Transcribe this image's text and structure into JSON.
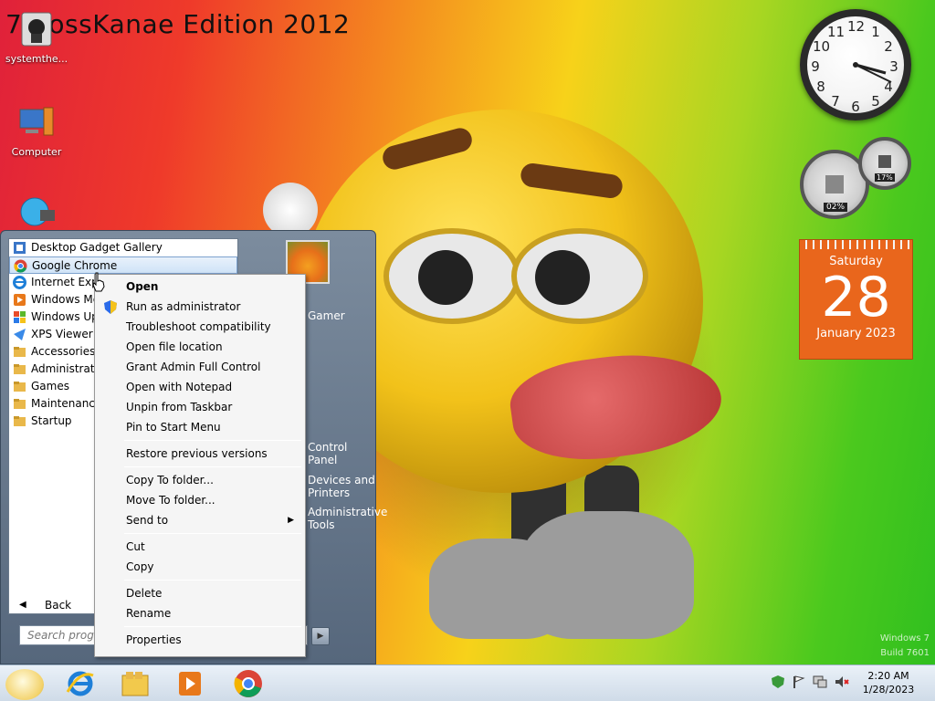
{
  "desktop": {
    "title": "7 BossKanae Edition 2012",
    "icons": [
      {
        "label": "systemthe..."
      },
      {
        "label": "Computer"
      }
    ],
    "watermark": [
      "Windows 7",
      "Build 7601"
    ]
  },
  "gadgets": {
    "clock": {
      "numbers": [
        "12",
        "1",
        "2",
        "3",
        "4",
        "5",
        "6",
        "7",
        "8",
        "9",
        "10",
        "11"
      ]
    },
    "cpu_meter": {
      "cpu": "02%",
      "memory": "17%"
    },
    "calendar": {
      "weekday": "Saturday",
      "day": "28",
      "month_year": "January 2023"
    }
  },
  "start_menu": {
    "programs": [
      {
        "label": "Desktop Gadget Gallery",
        "icon": "gadget-icon",
        "selected": false
      },
      {
        "label": "Google Chrome",
        "icon": "chrome-icon",
        "selected": true
      },
      {
        "label": "Internet Explorer",
        "icon": "ie-icon",
        "selected": false
      },
      {
        "label": "Windows Media Player",
        "icon": "media-player-icon",
        "selected": false
      },
      {
        "label": "Windows Update",
        "icon": "update-icon",
        "selected": false
      },
      {
        "label": "XPS Viewer",
        "icon": "xps-icon",
        "selected": false
      },
      {
        "label": "Accessories",
        "icon": "folder-icon",
        "selected": false
      },
      {
        "label": "Administrative Tools",
        "icon": "folder-icon",
        "selected": false
      },
      {
        "label": "Games",
        "icon": "folder-icon",
        "selected": false
      },
      {
        "label": "Maintenance",
        "icon": "folder-icon",
        "selected": false
      },
      {
        "label": "Startup",
        "icon": "folder-icon",
        "selected": false
      }
    ],
    "back_label": "Back",
    "search_placeholder": "Search programs and files",
    "right_items": [
      "Gamer",
      "Control Panel",
      "Devices and Printers",
      "Administrative Tools"
    ]
  },
  "context_menu": {
    "groups": [
      [
        {
          "label": "Open",
          "bold": true
        },
        {
          "label": "Run as administrator",
          "icon": "uac-shield-icon"
        },
        {
          "label": "Troubleshoot compatibility"
        },
        {
          "label": "Open file location"
        },
        {
          "label": "Grant Admin Full Control"
        },
        {
          "label": "Open with Notepad"
        },
        {
          "label": "Unpin from Taskbar"
        },
        {
          "label": "Pin to Start Menu"
        }
      ],
      [
        {
          "label": "Restore previous versions"
        }
      ],
      [
        {
          "label": "Copy To folder..."
        },
        {
          "label": "Move To folder..."
        },
        {
          "label": "Send to",
          "submenu": true
        }
      ],
      [
        {
          "label": "Cut"
        },
        {
          "label": "Copy"
        }
      ],
      [
        {
          "label": "Delete"
        },
        {
          "label": "Rename"
        }
      ],
      [
        {
          "label": "Properties"
        }
      ]
    ]
  },
  "taskbar": {
    "pinned": [
      "internet-explorer-icon",
      "libraries-folder-icon",
      "media-player-icon",
      "chrome-icon"
    ],
    "tray_icons": [
      "security-icon",
      "action-center-flag-icon",
      "network-icon",
      "volume-muted-icon"
    ],
    "time": "2:20 AM",
    "date": "1/28/2023"
  },
  "colors": {
    "calendar_orange": "#e9661c",
    "start_menu_blue": "#56677c",
    "selection_blue": "#cfe3f7"
  }
}
